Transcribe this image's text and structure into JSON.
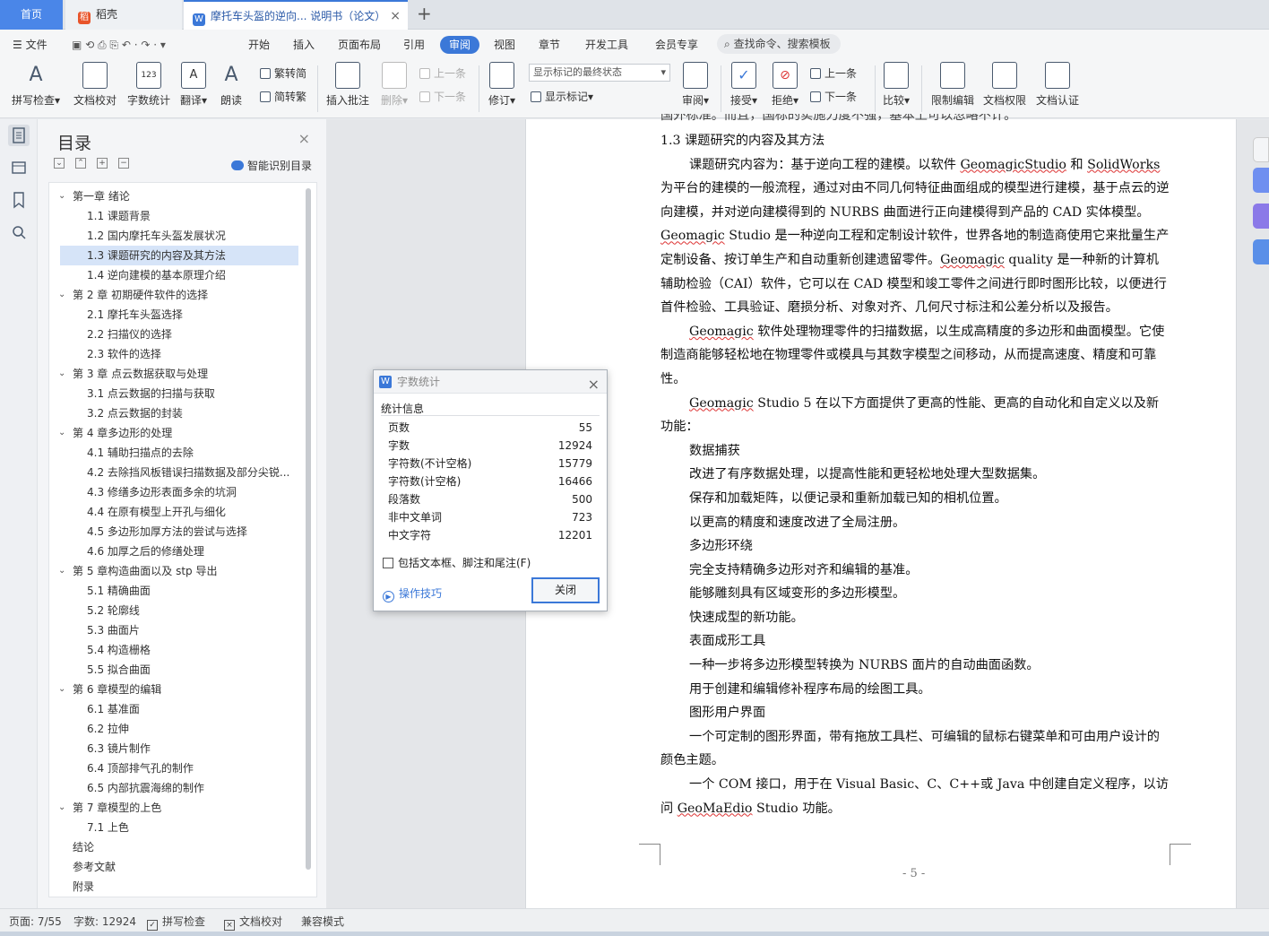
{
  "tabs": {
    "home": "首页",
    "daoke": "稻壳",
    "document": "摩托车头盔的逆向... 说明书（论文）",
    "add": "+"
  },
  "menu": {
    "file": "文件",
    "items": [
      "开始",
      "插入",
      "页面布局",
      "引用",
      "审阅",
      "视图",
      "章节",
      "开发工具",
      "会员专享"
    ],
    "search": "查找命令、搜索模板"
  },
  "ribbon": {
    "spellcheck": "拼写检查",
    "doccheck": "文档校对",
    "wordcount": "字数统计",
    "translate": "翻译",
    "read": "朗读",
    "to_traditional": "繁转简",
    "to_simplified": "简转繁",
    "insert_comment": "插入批注",
    "delete": "删除",
    "prev": "上一条",
    "next": "下一条",
    "revise": "修订",
    "markup_state": "显示标记的最终状态",
    "show_markup": "显示标记",
    "review": "审阅",
    "accept": "接受",
    "reject": "拒绝",
    "prev2": "上一条",
    "next2": "下一条",
    "compare": "比较",
    "restrict_edit": "限制编辑",
    "doc_permission": "文档权限",
    "doc_auth": "文档认证"
  },
  "toc": {
    "title": "目录",
    "ai_label": "智能识别目录",
    "items": [
      {
        "level": 1,
        "text": "第一章  绪论"
      },
      {
        "level": 2,
        "text": "1.1 课题背景"
      },
      {
        "level": 2,
        "text": "1.2 国内摩托车头盔发展状况"
      },
      {
        "level": 2,
        "text": "1.3 课题研究的内容及其方法"
      },
      {
        "level": 2,
        "text": "1.4 逆向建模的基本原理介绍"
      },
      {
        "level": 1,
        "text": "第 2 章  初期硬件软件的选择"
      },
      {
        "level": 2,
        "text": "2.1 摩托车头盔选择"
      },
      {
        "level": 2,
        "text": "2.2 扫描仪的选择"
      },
      {
        "level": 2,
        "text": "2.3  软件的选择"
      },
      {
        "level": 1,
        "text": "第 3 章    点云数据获取与处理"
      },
      {
        "level": 2,
        "text": "3.1  点云数据的扫描与获取"
      },
      {
        "level": 2,
        "text": "3.2  点云数据的封装"
      },
      {
        "level": 1,
        "text": "第 4 章多边形的处理"
      },
      {
        "level": 2,
        "text": "4.1  辅助扫描点的去除"
      },
      {
        "level": 2,
        "text": "4.2  去除挡风板错误扫描数据及部分尖锐..."
      },
      {
        "level": 2,
        "text": "4.3  修缮多边形表面多余的坑洞"
      },
      {
        "level": 2,
        "text": "4.4  在原有模型上开孔与细化"
      },
      {
        "level": 2,
        "text": "4.5  多边形加厚方法的尝试与选择"
      },
      {
        "level": 2,
        "text": "4.6  加厚之后的修缮处理"
      },
      {
        "level": 1,
        "text": "第 5 章构造曲面以及 stp 导出"
      },
      {
        "level": 2,
        "text": "5.1  精确曲面"
      },
      {
        "level": 2,
        "text": "5.2  轮廓线"
      },
      {
        "level": 2,
        "text": "5.3  曲面片"
      },
      {
        "level": 2,
        "text": "5.4  构造栅格"
      },
      {
        "level": 2,
        "text": "5.5  拟合曲面"
      },
      {
        "level": 1,
        "text": "第 6 章模型的编辑"
      },
      {
        "level": 2,
        "text": "6.1  基准面"
      },
      {
        "level": 2,
        "text": "6.2  拉伸"
      },
      {
        "level": 2,
        "text": "6.3  镜片制作"
      },
      {
        "level": 2,
        "text": "6.4  顶部排气孔的制作"
      },
      {
        "level": 2,
        "text": "6.5  内部抗震海绵的制作"
      },
      {
        "level": 1,
        "text": "第 7 章模型的上色"
      },
      {
        "level": 2,
        "text": "7.1  上色"
      },
      {
        "level": 0,
        "text": "结论"
      },
      {
        "level": 0,
        "text": "参考文献"
      },
      {
        "level": 0,
        "text": "附录"
      }
    ],
    "selected_index": 3
  },
  "document": {
    "top_cut": "国外标准。而且，国标的实施力度不强，基本上可以忽略不计。",
    "heading": "1.3 课题研究的内容及其方法",
    "p1a": "课题研究内容为：基于逆向工程的建模。以软件 ",
    "p1_w1": "GeomagicStudio",
    "p1b": " 和 ",
    "p1_w2": "SolidWorks",
    "p1c": " 为平台的建模的一般流程，通过对由不同几何特征曲面组成的模型进行建模，基于点云的逆向建模，并对逆向建模得到的 NURBS 曲面进行正向建模得到产品的 CAD 实体模型。",
    "p1_w3": "Geomagic",
    "p1d": " Studio 是一种逆向工程和定制设计软件，世界各地的制造商使用它来批量生产定制设备、按订单生产和自动重新创建遗留零件。",
    "p1_w4": "Geomagic",
    "p1e": " quality 是一种新的计算机辅助检验（CAI）软件，它可以在 CAD 模型和竣工零件之间进行即时图形比较，以便进行首件检验、工具验证、磨损分析、对象对齐、几何尺寸标注和公差分析以及报告。",
    "p2_w": "Geomagic",
    "p2": " 软件处理物理零件的扫描数据，以生成高精度的多边形和曲面模型。它使制造商能够轻松地在物理零件或模具与其数字模型之间移动，从而提高速度、精度和可靠性。",
    "p3_w": "Geomagic",
    "p3": " Studio 5 在以下方面提供了更高的性能、更高的自动化和自定义以及新功能：",
    "lines": [
      "数据捕获",
      "改进了有序数据处理，以提高性能和更轻松地处理大型数据集。",
      "保存和加载矩阵，以便记录和重新加载已知的相机位置。",
      "以更高的精度和速度改进了全局注册。",
      "多边形环绕",
      "完全支持精确多边形对齐和编辑的基准。",
      "能够雕刻具有区域变形的多边形模型。",
      "快速成型的新功能。",
      "表面成形工具",
      "一种一步将多边形模型转换为 NURBS 面片的自动曲面函数。",
      "用于创建和编辑修补程序布局的绘图工具。",
      "图形用户界面"
    ],
    "p4": "一个可定制的图形界面，带有拖放工具栏、可编辑的鼠标右键菜单和可由用户设计的颜色主题。",
    "p5a": "一个 COM 接口，用于在 Visual Basic、C、C++或 Java 中创建自定义程序，以访问 ",
    "p5_w": "GeoMaEdio",
    "p5b": " Studio 功能。",
    "page_number": "- 5 -"
  },
  "dialog": {
    "title": "字数统计",
    "section": "统计信息",
    "stats": [
      {
        "label": "页数",
        "value": "55"
      },
      {
        "label": "字数",
        "value": "12924"
      },
      {
        "label": "字符数(不计空格)",
        "value": "15779"
      },
      {
        "label": "字符数(计空格)",
        "value": "16466"
      },
      {
        "label": "段落数",
        "value": "500"
      },
      {
        "label": "非中文单词",
        "value": "723"
      },
      {
        "label": "中文字符",
        "value": "12201"
      }
    ],
    "checkbox": "包括文本框、脚注和尾注(F)",
    "tips": "操作技巧",
    "close": "关闭"
  },
  "status": {
    "page": "页面: 7/55",
    "words": "字数: 12924",
    "spell": "拼写检查",
    "proof": "文档校对",
    "compat": "兼容模式"
  },
  "colors": {
    "accent": "#3b78d8",
    "home_tab": "#4a86e8",
    "selected_toc": "#d6e4f8"
  }
}
